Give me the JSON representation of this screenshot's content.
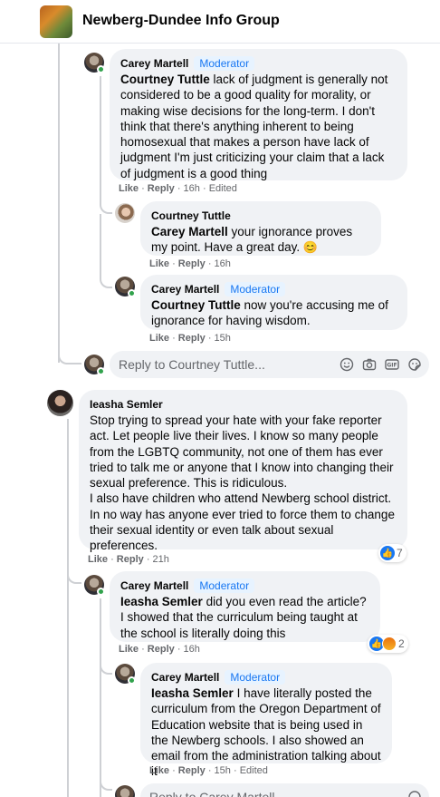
{
  "header": {
    "group_name": "Newberg-Dundee Info Group"
  },
  "badge": "Moderator",
  "comments": [
    {
      "author": "Carey Martell",
      "mention": "Courtney Tuttle",
      "text": " lack of judgment is generally not considered to be a good quality for morality, or making wise decisions for the long-term. I don't think that there's anything inherent to being homosexual that makes a person have lack of judgment I'm just criticizing your claim that a lack of judgment is a good thing",
      "like": "Like",
      "reply": "Reply",
      "time": "16h",
      "edited": "Edited"
    },
    {
      "author": "Courtney Tuttle",
      "mention": "Carey Martell",
      "text": " your ignorance proves my point. Have a great day.",
      "emoji": "😊",
      "like": "Like",
      "reply": "Reply",
      "time": "16h"
    },
    {
      "author": "Carey Martell",
      "mention": "Courtney Tuttle",
      "text": " now you're accusing me of ignorance for having wisdom.",
      "like": "Like",
      "reply": "Reply",
      "time": "15h"
    },
    {
      "author": "Ieasha Semler",
      "text": "Stop trying to spread your hate with your fake reporter act. Let people live their lives. I know so many people from the LGBTQ community, not one of them has ever tried to talk me or anyone that I know into changing their sexual preference. This is ridiculous.\nI also have children who attend Newberg school district. In no way has anyone ever tried to force them to change their sexual identity or even talk about sexual preferences.",
      "like": "Like",
      "reply": "Reply",
      "time": "21h",
      "reaction_count": "7"
    },
    {
      "author": "Carey Martell",
      "mention": "Ieasha Semler",
      "text": " did you even read the article? I showed that the curriculum being taught at the school is literally doing this",
      "like": "Like",
      "reply": "Reply",
      "time": "16h",
      "reaction_count": "2"
    },
    {
      "author": "Carey Martell",
      "mention": "Ieasha Semler",
      "text": " I have literally posted the curriculum from the Oregon Department of Education website that is being used in the Newberg schools. I also showed an email from the administration talking about it",
      "like": "Like",
      "reply": "Reply",
      "time": "15h",
      "edited": "Edited"
    }
  ],
  "reply_box_1": {
    "placeholder": "Reply to Courtney Tuttle..."
  },
  "reply_box_2": {
    "placeholder": "Reply to Carey Martell..."
  },
  "icons": [
    "smiley-icon",
    "camera-icon",
    "gif-icon",
    "sticker-icon"
  ]
}
